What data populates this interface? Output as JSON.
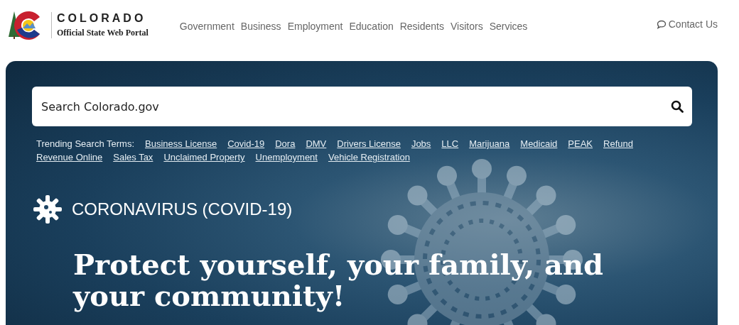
{
  "header": {
    "logo_title": "COLORADO",
    "logo_subtitle": "Official State Web Portal",
    "nav": [
      "Government",
      "Business",
      "Employment",
      "Education",
      "Residents",
      "Visitors",
      "Services"
    ],
    "contact": "Contact Us"
  },
  "hero": {
    "search": {
      "placeholder": "Search Colorado.gov"
    },
    "trending_label": "Trending Search Terms:",
    "trending_terms": [
      "Business License",
      "Covid-19",
      "Dora",
      "DMV",
      "Drivers License",
      "Jobs",
      "LLC",
      "Marijuana",
      "Medicaid",
      "PEAK",
      "Refund",
      "Revenue Online",
      "Sales Tax",
      "Unclaimed Property",
      "Unemployment",
      "Vehicle Registration"
    ],
    "alert_label": "CORONAVIRUS (COVID-19)",
    "headline": "Protect yourself, your family, and your community!"
  }
}
